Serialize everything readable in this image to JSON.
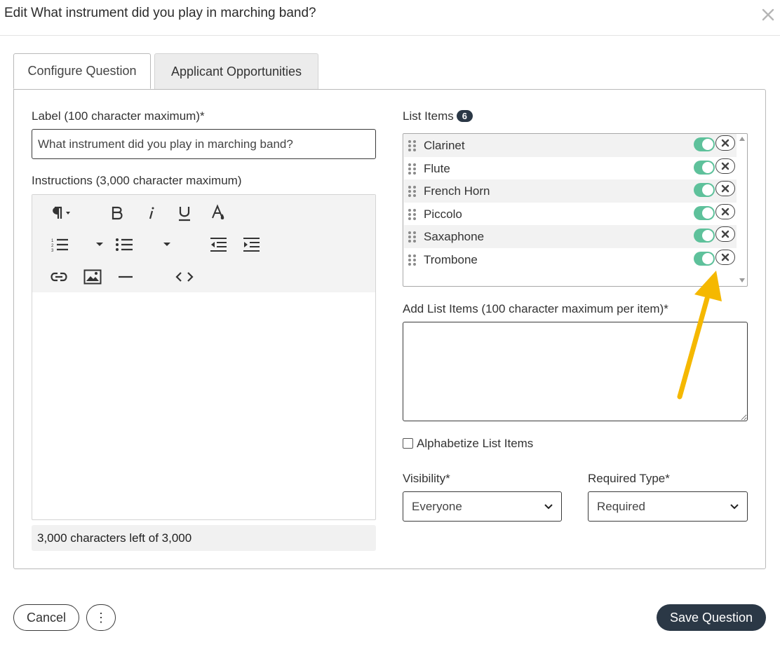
{
  "modal": {
    "title": "Edit What instrument did you play in marching band?",
    "close_icon": "close-icon"
  },
  "tabs": [
    {
      "label": "Configure Question",
      "active": true
    },
    {
      "label": "Applicant Opportunities",
      "active": false
    }
  ],
  "label_field": {
    "label": "Label (100 character maximum)*",
    "value": "What instrument did you play in marching band?"
  },
  "instructions": {
    "label": "Instructions (3,000 character maximum)",
    "char_count": "3,000 characters left of 3,000",
    "toolbar_icons": [
      "paragraph-icon",
      "bold-icon",
      "italic-icon",
      "underline-icon",
      "font-color-icon",
      "ordered-list-icon",
      "unordered-list-icon",
      "outdent-icon",
      "indent-icon",
      "link-icon",
      "image-icon",
      "horizontal-rule-icon",
      "code-view-icon"
    ]
  },
  "list_items": {
    "label": "List Items",
    "count": "6",
    "items": [
      {
        "label": "Clarinet",
        "enabled": true
      },
      {
        "label": "Flute",
        "enabled": true
      },
      {
        "label": "French Horn",
        "enabled": true
      },
      {
        "label": "Piccolo",
        "enabled": true
      },
      {
        "label": "Saxaphone",
        "enabled": true
      },
      {
        "label": "Trombone",
        "enabled": true
      }
    ],
    "toggle_color": "#5ec19b"
  },
  "add_list_items": {
    "label": "Add List Items (100 character maximum per item)*",
    "value": ""
  },
  "alphabetize": {
    "label": "Alphabetize List Items",
    "checked": false
  },
  "visibility": {
    "label": "Visibility*",
    "selected": "Everyone"
  },
  "required_type": {
    "label": "Required Type*",
    "selected": "Required"
  },
  "footer": {
    "cancel_label": "Cancel",
    "more_label": "⋮",
    "save_label": "Save Question"
  },
  "annotation_arrow_color": "#f5b800",
  "colors": {
    "primary": "#2b3846"
  }
}
